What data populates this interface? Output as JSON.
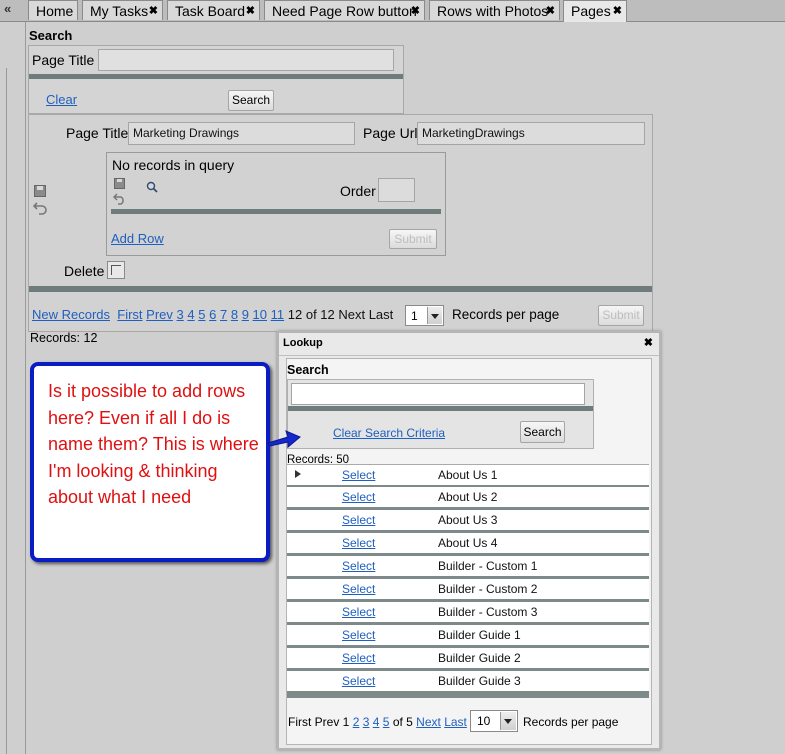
{
  "tabs": {
    "collapse": "«",
    "items": [
      {
        "label": "Home"
      },
      {
        "label": "My Tasks",
        "close": "✖"
      },
      {
        "label": "Task Board",
        "close": "✖"
      },
      {
        "label": "Need Page Row button",
        "close": "✖"
      },
      {
        "label": "Rows with Photos",
        "close": "✖"
      },
      {
        "label": "Pages",
        "close": "✖"
      }
    ]
  },
  "search": {
    "heading": "Search",
    "page_title_label": "Page Title",
    "page_title_value": "",
    "clear": "Clear",
    "search_button": "Search"
  },
  "detail": {
    "page_title_label": "Page Title",
    "page_title_value": "Marketing Drawings",
    "page_url_label": "Page Url",
    "page_url_value": "MarketingDrawings",
    "subgrid": {
      "empty_text": "No records in query",
      "order_label": "Order",
      "order_value": "",
      "add_row": "Add Row",
      "submit": "Submit"
    },
    "delete_label": "Delete"
  },
  "pager": {
    "new_records": "New Records",
    "first": "First",
    "prev": "Prev",
    "pages": [
      "3",
      "4",
      "5",
      "6",
      "7",
      "8",
      "9",
      "10",
      "11"
    ],
    "status": "12 of 12 Next Last",
    "per_page_value": "1",
    "per_page_label": "Records per page",
    "submit": "Submit"
  },
  "records_count": "Records:  12",
  "lookup": {
    "title": "Lookup",
    "close": "✖",
    "search_heading": "Search",
    "search_value": "",
    "clear": "Clear Search Criteria",
    "search_button": "Search",
    "records": "Records:  50",
    "select_label": "Select",
    "rows": [
      "About Us 1",
      "About Us 2",
      "About Us 3",
      "About Us 4",
      "Builder - Custom 1",
      "Builder - Custom 2",
      "Builder - Custom 3",
      "Builder Guide 1",
      "Builder Guide 2",
      "Builder Guide 3"
    ],
    "pager": {
      "prefix": "First Prev 1",
      "pages": [
        "2",
        "3",
        "4",
        "5"
      ],
      "of": "of 5",
      "next": "Next",
      "last": "Last",
      "per_page_value": "10",
      "per_page_label": "Records per page"
    }
  },
  "callout": {
    "text": "Is it possible to add rows here?  Even if all I do is name them?  This is where I'm looking & thinking about what I need"
  },
  "colors": {
    "callout_border": "#0a1dc4",
    "callout_text": "#e01010",
    "link": "#1f5fbf"
  }
}
